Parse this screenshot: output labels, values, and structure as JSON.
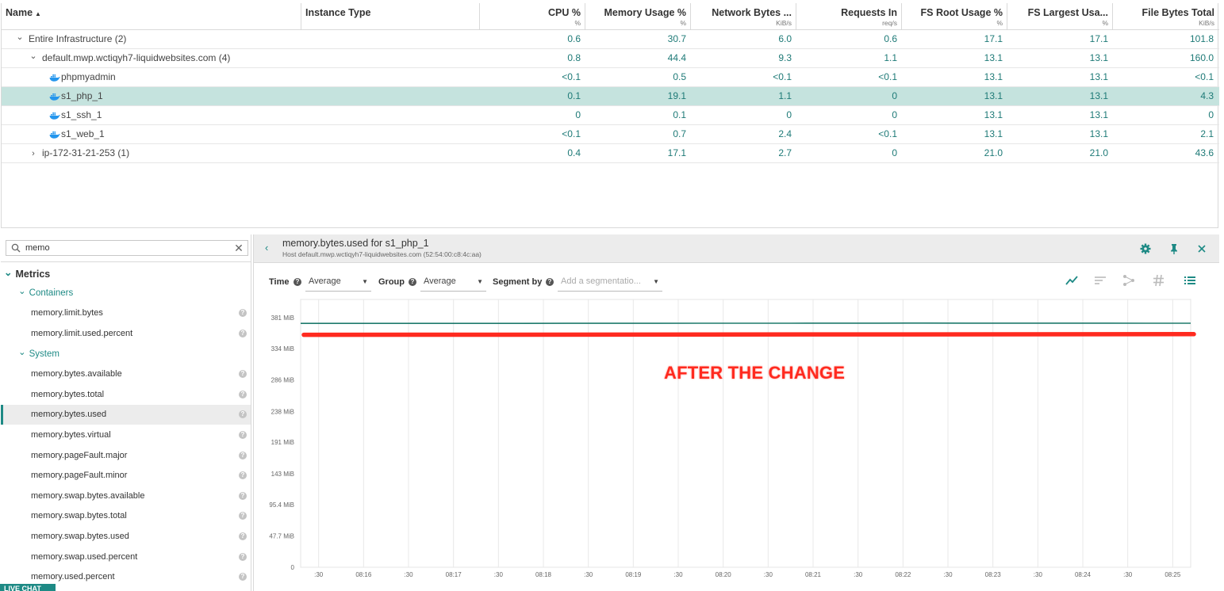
{
  "table": {
    "columns": [
      {
        "label": "Name",
        "unit": "",
        "sorted": true
      },
      {
        "label": "Instance Type",
        "unit": ""
      },
      {
        "label": "CPU %",
        "unit": "%"
      },
      {
        "label": "Memory Usage %",
        "unit": "%"
      },
      {
        "label": "Network Bytes ...",
        "unit": "KiB/s"
      },
      {
        "label": "Requests In",
        "unit": "req/s"
      },
      {
        "label": "FS Root Usage %",
        "unit": "%"
      },
      {
        "label": "FS Largest Usa...",
        "unit": "%"
      },
      {
        "label": "File Bytes Total",
        "unit": "KiB/s"
      }
    ],
    "sort_indicator": "▲",
    "rows": [
      {
        "name": "Entire Infrastructure (2)",
        "level": 0,
        "toggle": "expanded",
        "icon": "",
        "instance": "",
        "values": [
          "0.6",
          "30.7",
          "6.0",
          "0.6",
          "17.1",
          "17.1",
          "101.8"
        ]
      },
      {
        "name": "default.mwp.wctiqyh7-liquidwebsites.com (4)",
        "level": 1,
        "toggle": "expanded",
        "icon": "",
        "instance": "",
        "values": [
          "0.8",
          "44.4",
          "9.3",
          "1.1",
          "13.1",
          "13.1",
          "160.0"
        ]
      },
      {
        "name": "phpmyadmin",
        "level": 2,
        "toggle": "",
        "icon": "docker-icon",
        "instance": "",
        "values": [
          "<0.1",
          "0.5",
          "<0.1",
          "<0.1",
          "13.1",
          "13.1",
          "<0.1"
        ]
      },
      {
        "name": "s1_php_1",
        "level": 2,
        "toggle": "",
        "icon": "docker-icon",
        "instance": "",
        "selected": true,
        "values": [
          "0.1",
          "19.1",
          "1.1",
          "0",
          "13.1",
          "13.1",
          "4.3"
        ]
      },
      {
        "name": "s1_ssh_1",
        "level": 2,
        "toggle": "",
        "icon": "docker-icon",
        "instance": "",
        "values": [
          "0",
          "0.1",
          "0",
          "0",
          "13.1",
          "13.1",
          "0"
        ]
      },
      {
        "name": "s1_web_1",
        "level": 2,
        "toggle": "",
        "icon": "docker-icon",
        "instance": "",
        "values": [
          "<0.1",
          "0.7",
          "2.4",
          "<0.1",
          "13.1",
          "13.1",
          "2.1"
        ]
      },
      {
        "name": "ip-172-31-21-253 (1)",
        "level": 1,
        "toggle": "collapsed",
        "icon": "",
        "instance": "",
        "values": [
          "0.4",
          "17.1",
          "2.7",
          "0",
          "21.0",
          "21.0",
          "43.6"
        ]
      }
    ]
  },
  "search": {
    "value": "memo",
    "placeholder": ""
  },
  "metrics_tree": {
    "title": "Metrics",
    "groups": [
      {
        "label": "Containers",
        "items": [
          "memory.limit.bytes",
          "memory.limit.used.percent"
        ]
      },
      {
        "label": "System",
        "items": [
          "memory.bytes.available",
          "memory.bytes.total",
          "memory.bytes.used",
          "memory.bytes.virtual",
          "memory.pageFault.major",
          "memory.pageFault.minor",
          "memory.swap.bytes.available",
          "memory.swap.bytes.total",
          "memory.swap.bytes.used",
          "memory.swap.used.percent",
          "memory.used.percent"
        ]
      }
    ],
    "active_item": "memory.bytes.used"
  },
  "live_chat": "LIVE CHAT",
  "panel": {
    "title": "memory.bytes.used for s1_php_1",
    "subtitle": "Host default.mwp.wctiqyh7-liquidwebsites.com (52:54:00:c8:4c:aa)"
  },
  "toolbar": {
    "time_label": "Time",
    "time_value": "Average",
    "group_label": "Group",
    "group_value": "Average",
    "segment_label": "Segment by",
    "segment_placeholder": "Add a segmentatio..."
  },
  "annotation": "AFTER THE CHANGE",
  "colors": {
    "accent": "#1e8a85",
    "series": "#1e7a6c",
    "annotation": "#ff2a1f",
    "selected_row": "#c5e3de"
  },
  "chart_data": {
    "type": "line",
    "title": "",
    "xlabel": "",
    "ylabel": "",
    "y_ticks": [
      "0",
      "47.7 MiB",
      "95.4 MiB",
      "143 MiB",
      "191 MiB",
      "238 MiB",
      "286 MiB",
      "334 MiB",
      "381 MiB"
    ],
    "y_tick_values": [
      0,
      47.7,
      95.4,
      143,
      191,
      238,
      286,
      334,
      381
    ],
    "ylim": [
      0,
      409
    ],
    "x_ticks": [
      ":30",
      "08:16",
      ":30",
      "08:17",
      ":30",
      "08:18",
      ":30",
      "08:19",
      ":30",
      "08:20",
      ":30",
      "08:21",
      ":30",
      "08:22",
      ":30",
      "08:23",
      ":30",
      "08:24",
      ":30",
      "08:25"
    ],
    "grid": true,
    "series": [
      {
        "values": [
          372.5,
          372.5,
          372.5,
          372.4,
          372.5,
          372.5,
          372.6,
          372.6,
          372.6,
          372.7,
          372.7,
          372.7,
          372.8,
          372.8,
          372.9,
          372.8,
          372.8,
          372.8,
          372.8,
          372.7,
          372.7
        ]
      }
    ],
    "annotation_line": {
      "values": [
        355,
        356
      ]
    }
  }
}
